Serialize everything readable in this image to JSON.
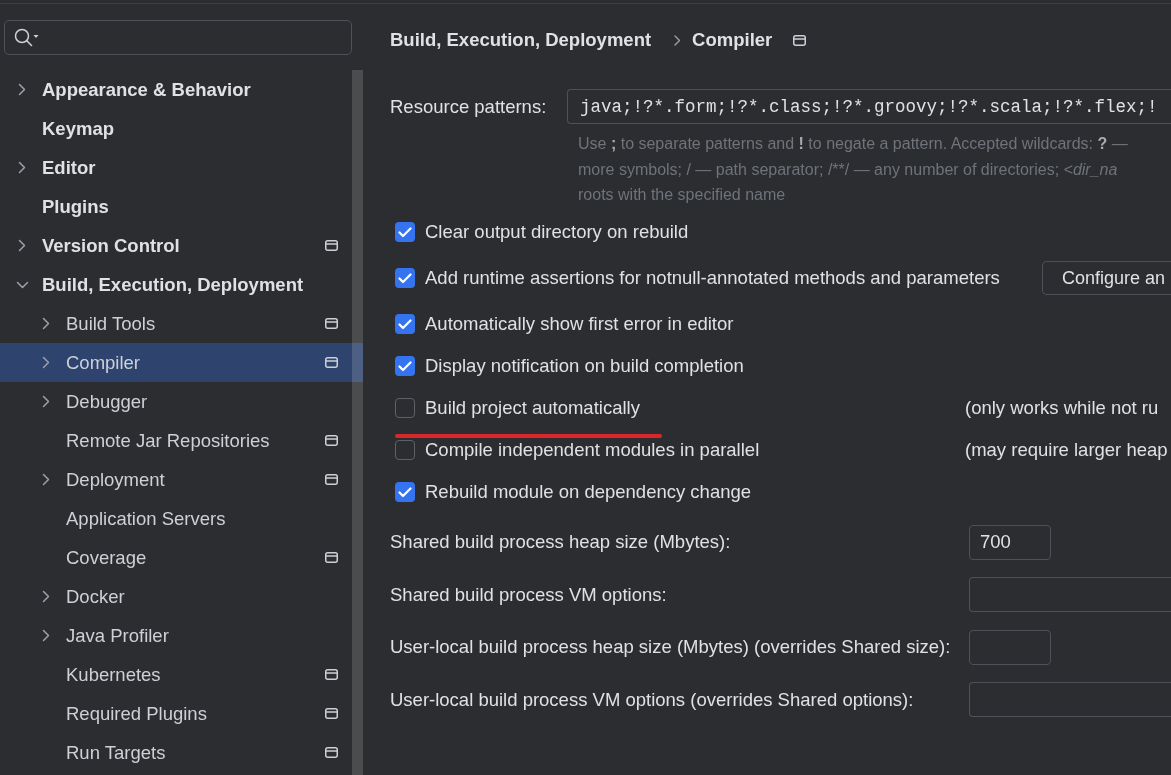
{
  "sidebar": {
    "items": [
      {
        "label": "Appearance & Behavior",
        "kind": "folder",
        "expanded": false,
        "selected": false
      },
      {
        "label": "Keymap",
        "kind": "leaf",
        "selected": false
      },
      {
        "label": "Editor",
        "kind": "folder",
        "expanded": false,
        "selected": false
      },
      {
        "label": "Plugins",
        "kind": "leaf",
        "selected": false
      },
      {
        "label": "Version Control",
        "kind": "folder",
        "expanded": false,
        "selected": false,
        "scope_icon": true
      },
      {
        "label": "Build, Execution, Deployment",
        "kind": "folder",
        "expanded": true,
        "selected": false,
        "children": [
          {
            "label": "Build Tools",
            "kind": "folder",
            "expanded": false,
            "selected": false,
            "scope_icon": true
          },
          {
            "label": "Compiler",
            "kind": "folder",
            "expanded": false,
            "selected": true,
            "scope_icon": true
          },
          {
            "label": "Debugger",
            "kind": "folder",
            "expanded": false,
            "selected": false
          },
          {
            "label": "Remote Jar Repositories",
            "kind": "leaf",
            "selected": false,
            "scope_icon": true
          },
          {
            "label": "Deployment",
            "kind": "folder",
            "expanded": false,
            "selected": false,
            "scope_icon": true
          },
          {
            "label": "Application Servers",
            "kind": "leaf",
            "selected": false
          },
          {
            "label": "Coverage",
            "kind": "leaf",
            "selected": false,
            "scope_icon": true
          },
          {
            "label": "Docker",
            "kind": "folder",
            "expanded": false,
            "selected": false
          },
          {
            "label": "Java Profiler",
            "kind": "folder",
            "expanded": false,
            "selected": false
          },
          {
            "label": "Kubernetes",
            "kind": "leaf",
            "selected": false,
            "scope_icon": true
          },
          {
            "label": "Required Plugins",
            "kind": "leaf",
            "selected": false,
            "scope_icon": true
          },
          {
            "label": "Run Targets",
            "kind": "leaf",
            "selected": false,
            "scope_icon": true
          }
        ]
      }
    ]
  },
  "breadcrumb": {
    "items": [
      "Build, Execution, Deployment",
      "Compiler"
    ],
    "scope_icon": true
  },
  "resource_patterns": {
    "label": "Resource patterns:",
    "value": "java;!?*.form;!?*.class;!?*.groovy;!?*.scala;!?*.flex;!",
    "hint": [
      [
        {
          "kind": "plain",
          "text": "Use "
        },
        {
          "kind": "bold",
          "text": ";"
        },
        {
          "kind": "plain",
          "text": " to separate patterns and "
        },
        {
          "kind": "bold",
          "text": "!"
        },
        {
          "kind": "plain",
          "text": " to negate a pattern. Accepted wildcards: "
        },
        {
          "kind": "bold",
          "text": "?"
        },
        {
          "kind": "plain",
          "text": " —"
        }
      ],
      [
        {
          "kind": "plain",
          "text": "more symbols; / — path separator; /**/ — any number of directories; "
        },
        {
          "kind": "italic",
          "text": "<dir_na"
        }
      ],
      [
        {
          "kind": "plain",
          "text": "roots with the specified name"
        }
      ]
    ]
  },
  "options": [
    {
      "label": "Clear output directory on rebuild",
      "checked": true
    },
    {
      "label": "Add runtime assertions for notnull-annotated methods and parameters",
      "checked": true,
      "button": "Configure an"
    },
    {
      "label": "Automatically show first error in editor",
      "checked": true
    },
    {
      "label": "Display notification on build completion",
      "checked": true
    },
    {
      "label": "Build project automatically",
      "checked": false,
      "note": "(only works while not ru",
      "underlined": true
    },
    {
      "label": "Compile independent modules in parallel",
      "checked": false,
      "note": "(may require larger heap"
    },
    {
      "label": "Rebuild module on dependency change",
      "checked": true
    }
  ],
  "fields": [
    {
      "label": "Shared build process heap size (Mbytes):",
      "kind": "short",
      "value": "700"
    },
    {
      "label": "Shared build process VM options:",
      "kind": "wide"
    },
    {
      "label": "User-local build process heap size (Mbytes) (overrides Shared size):",
      "kind": "short"
    },
    {
      "label": "User-local build process VM options (overrides Shared options):",
      "kind": "wide"
    }
  ]
}
